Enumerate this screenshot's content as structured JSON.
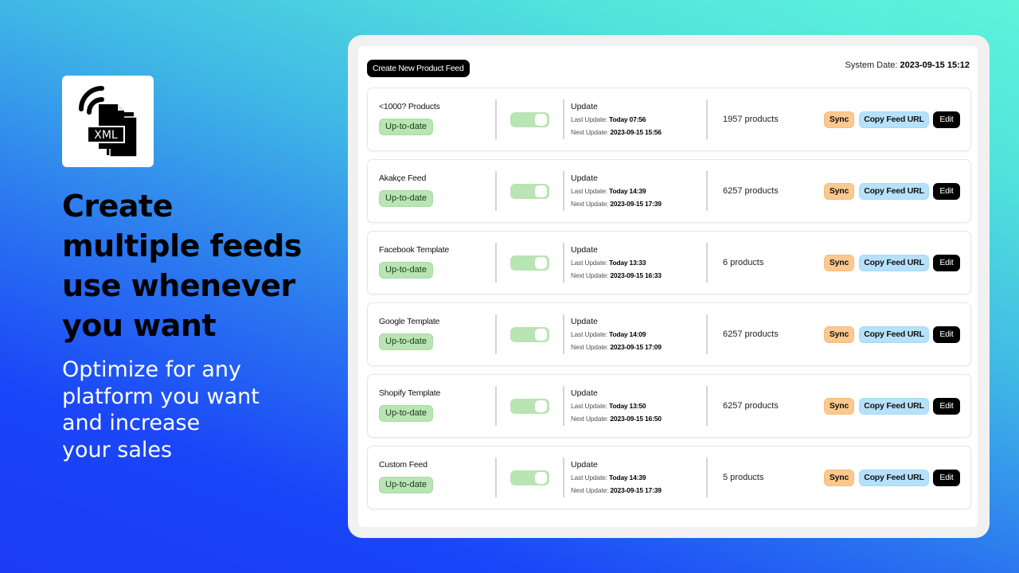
{
  "promo": {
    "logo_icon": "xml-feed-icon",
    "logo_text": "XML",
    "headline_lines": [
      "Create",
      "multiple feeds",
      "use whenever",
      "you want"
    ],
    "subline_lines": [
      "Optimize for any",
      "platform you want",
      "and increase",
      "your sales"
    ]
  },
  "toolbar": {
    "create_label": "Create New Product Feed",
    "system_date_label": "System Date:",
    "system_date_value": "2023-09-15 15:12"
  },
  "labels": {
    "update_title": "Update",
    "last_update": "Last Update:",
    "next_update": "Next Update:",
    "sync": "Sync",
    "copy_feed_url": "Copy Feed URL",
    "edit": "Edit"
  },
  "colors": {
    "status_green": "#b9e4b3",
    "sync_orange": "#fdc88e",
    "copy_blue": "#b6e1fb",
    "edit_black": "#000000"
  },
  "feeds": [
    {
      "name": "<1000? Products",
      "status": "Up-to-date",
      "enabled": true,
      "last_update": "Today 07:56",
      "next_update": "2023-09-15 15:56",
      "products": "1957 products"
    },
    {
      "name": "Akakçe Feed",
      "status": "Up-to-date",
      "enabled": true,
      "last_update": "Today 14:39",
      "next_update": "2023-09-15 17:39",
      "products": "6257 products"
    },
    {
      "name": "Facebook Template",
      "status": "Up-to-date",
      "enabled": true,
      "last_update": "Today 13:33",
      "next_update": "2023-09-15 16:33",
      "products": "6 products"
    },
    {
      "name": "Google Template",
      "status": "Up-to-date",
      "enabled": true,
      "last_update": "Today 14:09",
      "next_update": "2023-09-15 17:09",
      "products": "6257 products"
    },
    {
      "name": "Shopify Template",
      "status": "Up-to-date",
      "enabled": true,
      "last_update": "Today 13:50",
      "next_update": "2023-09-15 16:50",
      "products": "6257 products"
    },
    {
      "name": "Custom Feed",
      "status": "Up-to-date",
      "enabled": true,
      "last_update": "Today 14:39",
      "next_update": "2023-09-15 17:39",
      "products": "5 products"
    }
  ]
}
